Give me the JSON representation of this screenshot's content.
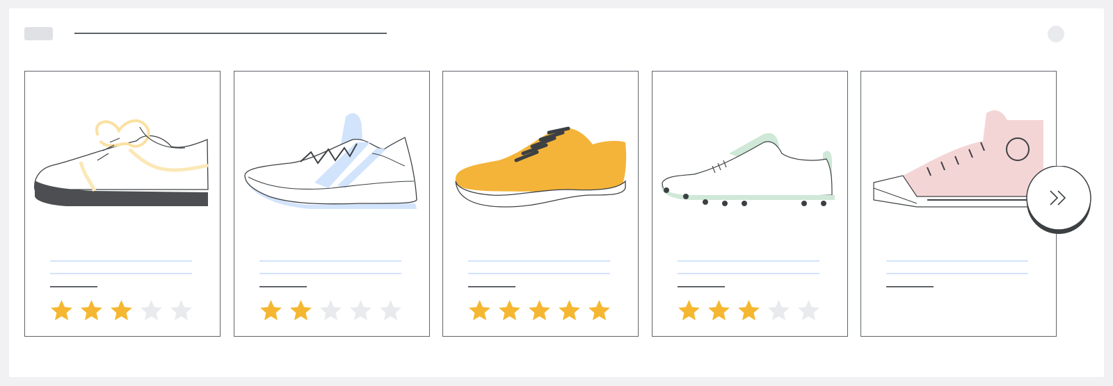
{
  "colors": {
    "star_filled": "#f5b731",
    "star_empty": "#e8eaed",
    "card_border": "#5f6368",
    "text_line": "#d2e3fc"
  },
  "cards": [
    {
      "shoe": "white-sneaker-with-yellow-laces",
      "rating": 3,
      "max_rating": 5
    },
    {
      "shoe": "white-running-shoe-with-blue-stripes",
      "rating": 2,
      "max_rating": 5
    },
    {
      "shoe": "yellow-knit-sneaker",
      "rating": 5,
      "max_rating": 5
    },
    {
      "shoe": "white-soccer-cleat-with-green-accents",
      "rating": 3,
      "max_rating": 5
    },
    {
      "shoe": "pink-high-top-sneaker",
      "rating": null,
      "max_rating": 5
    }
  ],
  "next_button": {
    "icon": "double-chevron-right-icon"
  }
}
